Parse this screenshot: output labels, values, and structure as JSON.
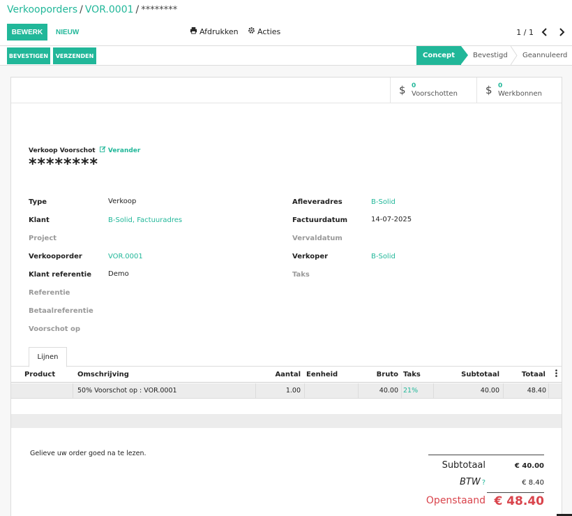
{
  "breadcrumb": {
    "part1": "Verkooporders",
    "part2": "VOR.0001",
    "part3": "********",
    "sep": "/"
  },
  "toolbar": {
    "edit_label": "BEWERK",
    "new_label": "NIEUW",
    "print_label": "Afdrukken",
    "actions_label": "Acties",
    "pager": "1 / 1"
  },
  "statusbar": {
    "buttons": [
      "BEVESTIGEN",
      "VERZENDEN"
    ],
    "stages": [
      "Concept",
      "Bevestigd",
      "Geannuleerd"
    ],
    "active_stage": "Concept"
  },
  "smart_buttons": [
    {
      "count": "0",
      "label": "Voorschotten",
      "icon": "dollar-icon"
    },
    {
      "count": "0",
      "label": "Werkbonnen",
      "icon": "dollar-icon"
    }
  ],
  "record": {
    "subtitle": "Verkoop Voorschot",
    "change_label": "Verander",
    "name": "********"
  },
  "fields_left": [
    {
      "label": "Type",
      "value": "Verkoop",
      "link": false,
      "muted": false
    },
    {
      "label": "Klant",
      "value": "B-Solid, Factuuradres",
      "link": true,
      "muted": false
    },
    {
      "label": "Project",
      "value": "",
      "link": false,
      "muted": true
    },
    {
      "label": "Verkooporder",
      "value": "VOR.0001",
      "link": true,
      "muted": false
    },
    {
      "label": "Klant referentie",
      "value": "Demo",
      "link": false,
      "muted": false
    },
    {
      "label": "Referentie",
      "value": "",
      "link": false,
      "muted": true
    },
    {
      "label": "Betaalreferentie",
      "value": "",
      "link": false,
      "muted": true
    },
    {
      "label": "Voorschot op",
      "value": "",
      "link": false,
      "muted": true
    }
  ],
  "fields_right": [
    {
      "label": "Afleveradres",
      "value": "B-Solid",
      "link": true,
      "muted": false
    },
    {
      "label": "Factuurdatum",
      "value": "14-07-2025",
      "link": false,
      "muted": false
    },
    {
      "label": "Vervaldatum",
      "value": "",
      "link": false,
      "muted": true
    },
    {
      "label": "Verkoper",
      "value": "B-Solid",
      "link": true,
      "muted": false
    },
    {
      "label": "Taks",
      "value": "",
      "link": false,
      "muted": true
    }
  ],
  "tabs": [
    "Lijnen"
  ],
  "lines": {
    "columns": [
      "Product",
      "Omschrijving",
      "Aantal",
      "Eenheid",
      "Bruto",
      "Taks",
      "Subtotaal",
      "Totaal"
    ],
    "rows": [
      {
        "product": "",
        "description": "50% Voorschot op : VOR.0001",
        "qty": "1.00",
        "unit": "",
        "gross": "40.00",
        "tax": "21%",
        "subtotal": "40.00",
        "total": "48.40"
      }
    ]
  },
  "note": "Gelieve uw order goed na te lezen.",
  "totals": {
    "subtotal_label": "Subtotaal",
    "subtotal_value": "€ 40.00",
    "tax_label": "BTW",
    "tax_help": "?",
    "tax_value": "€ 8.40",
    "open_label": "Openstaand",
    "open_value": "€ 48.40"
  },
  "colors": {
    "accent": "#21b799",
    "due": "#d9444c"
  }
}
